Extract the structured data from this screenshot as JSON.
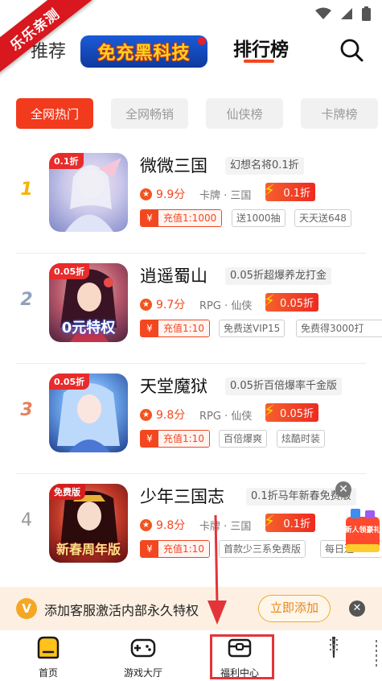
{
  "ribbon": {
    "text": "乐乐亲测"
  },
  "topnav": {
    "recommend": "推荐",
    "logo_text": "免充黑科技",
    "ranking": "排行榜"
  },
  "chips": [
    "全网热门",
    "全网畅销",
    "仙侠榜",
    "卡牌榜"
  ],
  "games": [
    {
      "rank": "1",
      "name": "微微三国",
      "tagline": "幻想名将0.1折",
      "score": "9.9分",
      "genre": "卡牌 · 三国",
      "discount": "0.1折",
      "cover_badge": "0.1折",
      "cover_caption": "",
      "recharge": "充值1:1000",
      "tags": [
        "送1000抽",
        "天天送648"
      ]
    },
    {
      "rank": "2",
      "name": "逍遥蜀山",
      "tagline": "0.05折超爆养龙打金",
      "score": "9.7分",
      "genre": "RPG · 仙侠",
      "discount": "0.05折",
      "cover_badge": "0.05折",
      "cover_caption": "0元特权",
      "recharge": "充值1:10",
      "tags": [
        "免费送VIP15",
        "免费得3000打"
      ]
    },
    {
      "rank": "3",
      "name": "天堂魔狱",
      "tagline": "0.05折百倍爆率千金版",
      "score": "9.8分",
      "genre": "RPG · 仙侠",
      "discount": "0.05折",
      "cover_badge": "0.05折",
      "cover_caption": "",
      "recharge": "充值1:10",
      "tags": [
        "百倍爆爽",
        "炫酷时装"
      ]
    },
    {
      "rank": "4",
      "name": "少年三国志",
      "tagline": "0.1折马年新春免费版",
      "score": "9.8分",
      "genre": "卡牌 · 三国",
      "discount": "0.1折",
      "cover_badge": "免费版",
      "cover_caption": "新春周年版",
      "recharge": "充值1:10",
      "tags": [
        "首款少三系免费版",
        "每日送0"
      ]
    }
  ],
  "float_gift": {
    "label": "新人领豪礼"
  },
  "cs_banner": {
    "icon": "V",
    "text": "添加客服激活内部永久特权",
    "button": "立即添加"
  },
  "tabs": [
    "首页",
    "游戏大厅",
    "福利中心",
    ""
  ],
  "colors": {
    "accent": "#f2471f",
    "ribbon": "#d8171e",
    "highlight": "#e3343a",
    "banner_bg": "#fdf0e2"
  }
}
